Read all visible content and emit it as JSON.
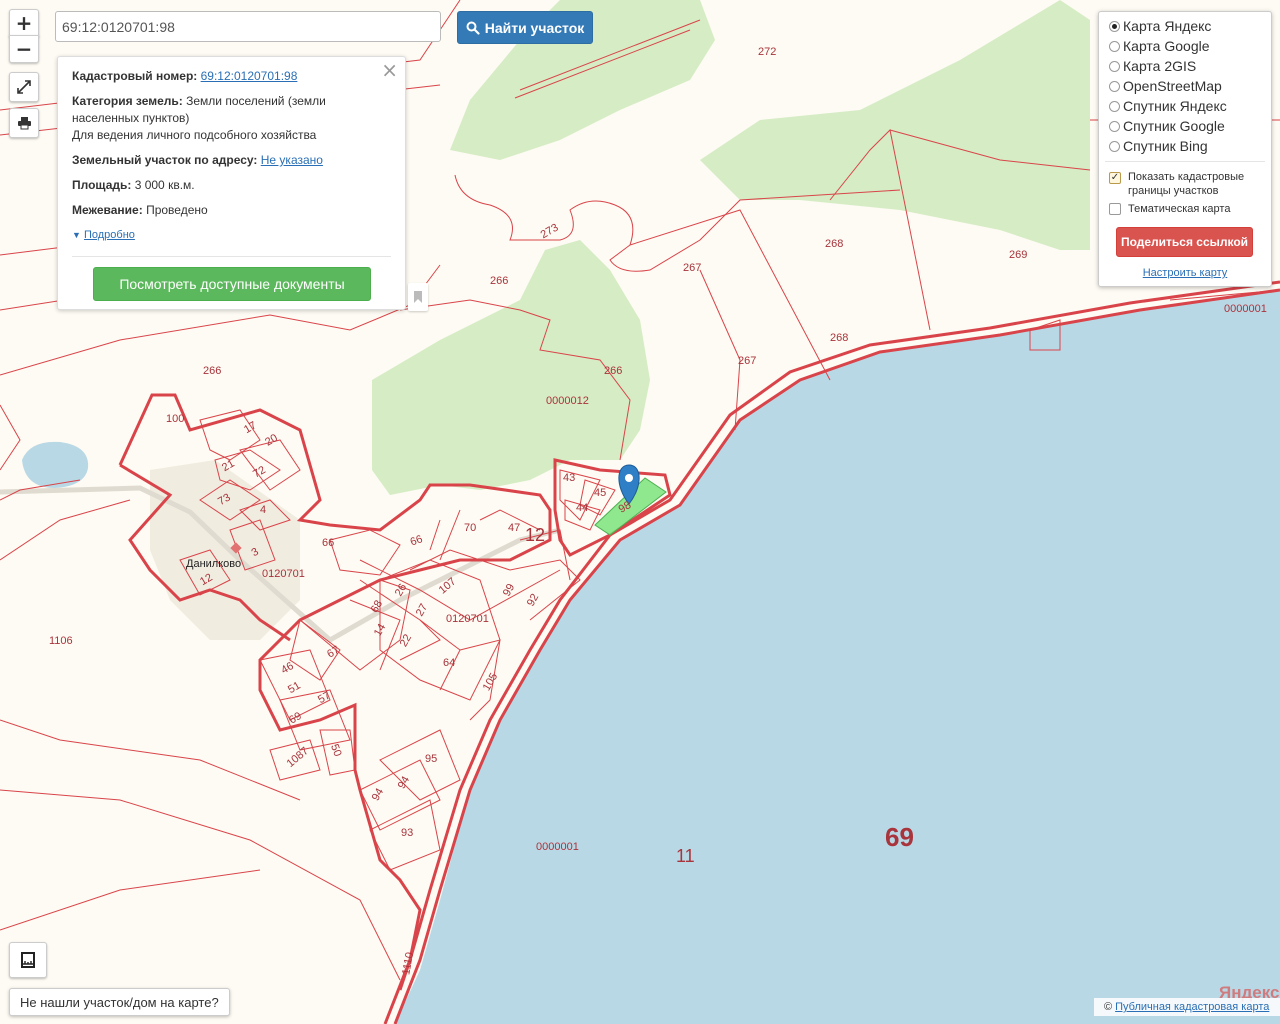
{
  "search": {
    "value": "69:12:0120701:98",
    "button_label": "Найти участок"
  },
  "zoom": {
    "in_label": "+",
    "out_label": "−"
  },
  "controls": {
    "fullscreen_icon": "expand-icon",
    "print_icon": "printer-icon",
    "ruler_icon": "ruler-icon"
  },
  "info_card": {
    "cad_label": "Кадастровый номер:",
    "cad_value": "69:12:0120701:98",
    "category_label": "Категория земель:",
    "category_value": "Земли поселений (земли",
    "category_value_2": "населенных пунктов)",
    "usage": "Для ведения личного подсобного хозяйства",
    "address_label": "Земельный участок по адресу:",
    "address_value": "Не указано",
    "area_label": "Площадь:",
    "area_value": "3 000 кв.м.",
    "survey_label": "Межевание:",
    "survey_value": "Проведено",
    "details_label": "Подробно",
    "docs_button": "Посмотреть доступные документы"
  },
  "layers": {
    "base": [
      {
        "label": "Карта Яндекс",
        "selected": true
      },
      {
        "label": "Карта Google",
        "selected": false
      },
      {
        "label": "Карта 2GIS",
        "selected": false
      },
      {
        "label": "OpenStreetMap",
        "selected": false
      },
      {
        "label": "Спутник Яндекс",
        "selected": false
      },
      {
        "label": "Спутник Google",
        "selected": false
      },
      {
        "label": "Спутник Bing",
        "selected": false
      }
    ],
    "show_cad_1": "Показать кадастровые",
    "show_cad_2": "границы участков",
    "show_cad_checked": true,
    "thematic": "Тематическая карта",
    "thematic_checked": false,
    "share_button": "Поделиться ссылкой",
    "configure_link": "Настроить карту"
  },
  "not_found_button": "Не нашли участок/дом на карте?",
  "attribution": {
    "prefix": "©",
    "link": "Публичная кадастровая карта"
  },
  "yandex_logo": "Яндекс",
  "map_labels": {
    "village": "Данилково",
    "n272": "272",
    "n273": "273",
    "n266a": "266",
    "n266b": "266",
    "n266c": "266",
    "n267a": "267",
    "n267b": "267",
    "n268a": "268",
    "n268b": "268",
    "n269": "269",
    "n0000001_top": "0000001",
    "n0000012": "0000012",
    "n100": "100",
    "n17": "17",
    "n20": "20",
    "n21": "21",
    "n72": "72",
    "n73": "73",
    "n4": "4",
    "n3": "3",
    "n12a": "12",
    "n66a": "66",
    "n66b": "66",
    "n70": "70",
    "n47": "47",
    "n12big": "12",
    "n43": "43",
    "n45": "45",
    "n44": "44",
    "n98": "98",
    "n0120701a": "0120701",
    "n0120701b": "0120701",
    "n107": "107",
    "n99": "99",
    "n92": "92",
    "n68": "68",
    "n26": "26",
    "n27": "27",
    "n14": "14",
    "n22": "22",
    "n64": "64",
    "n105": "105",
    "n67": "67",
    "n46": "46",
    "n51": "51",
    "n57": "57",
    "n69small": "69",
    "n1087": "1087",
    "n50": "50",
    "n95": "95",
    "n94a": "94",
    "n94b": "94",
    "n93": "93",
    "n1106": "1106",
    "n1110": "1110",
    "n0000001_bottom": "0000001",
    "n11": "11",
    "n69big": "69"
  },
  "colors": {
    "land": "#fdfbf3",
    "forest": "#d6ecc4",
    "water": "#b9d8e5",
    "boundary": "#d9444a",
    "selected_parcel": "#7be37b",
    "marker": "#2f7fc6"
  }
}
